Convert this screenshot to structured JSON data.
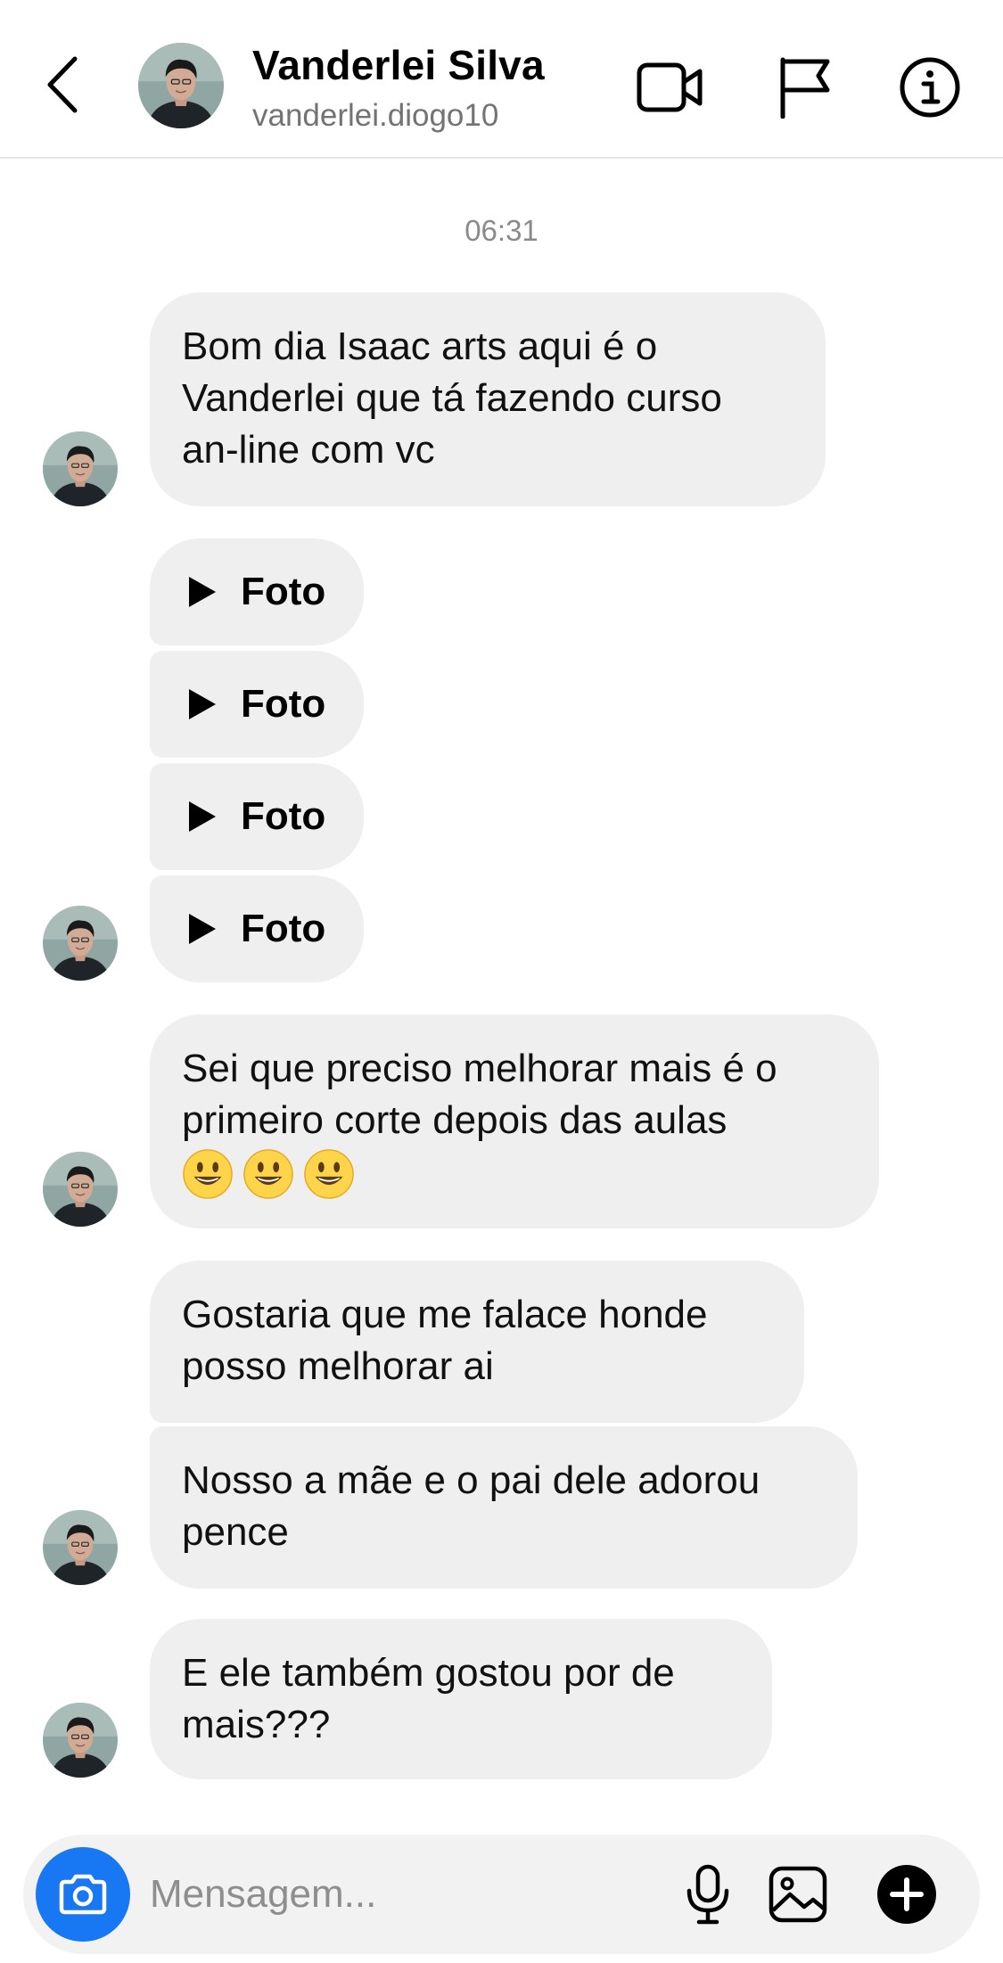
{
  "header": {
    "name": "Vanderlei Silva",
    "handle": "vanderlei.diogo10"
  },
  "icons": {
    "back": "chevron-left-icon",
    "video": "video-camera-icon",
    "flag": "flag-icon",
    "info": "info-icon",
    "camera": "camera-icon",
    "mic": "microphone-icon",
    "gallery": "image-icon",
    "plus": "plus-circle-icon"
  },
  "timestamp": "06:31",
  "messages": [
    {
      "type": "text",
      "text": "Bom dia Isaac arts aqui é o\nVanderlei que tá fazendo curso\nan-line com vc"
    },
    {
      "type": "foto",
      "label": "Foto"
    },
    {
      "type": "foto",
      "label": "Foto"
    },
    {
      "type": "foto",
      "label": "Foto"
    },
    {
      "type": "foto",
      "label": "Foto"
    },
    {
      "type": "text",
      "text": "Sei que preciso melhorar mais é o\nprimeiro corte depois das aulas",
      "emoji": "😃😃😃"
    },
    {
      "type": "text",
      "text": "Gostaria que me falace honde\nposso melhorar ai"
    },
    {
      "type": "text",
      "text": "Nosso a mãe e o pai dele adorou\npence"
    },
    {
      "type": "text",
      "text": "E ele também gostou por de\nmais???"
    }
  ],
  "composer": {
    "placeholder": "Mensagem..."
  },
  "colors": {
    "accent": "#1877f2",
    "bubble": "#efefef",
    "secondary_text": "#737373"
  }
}
